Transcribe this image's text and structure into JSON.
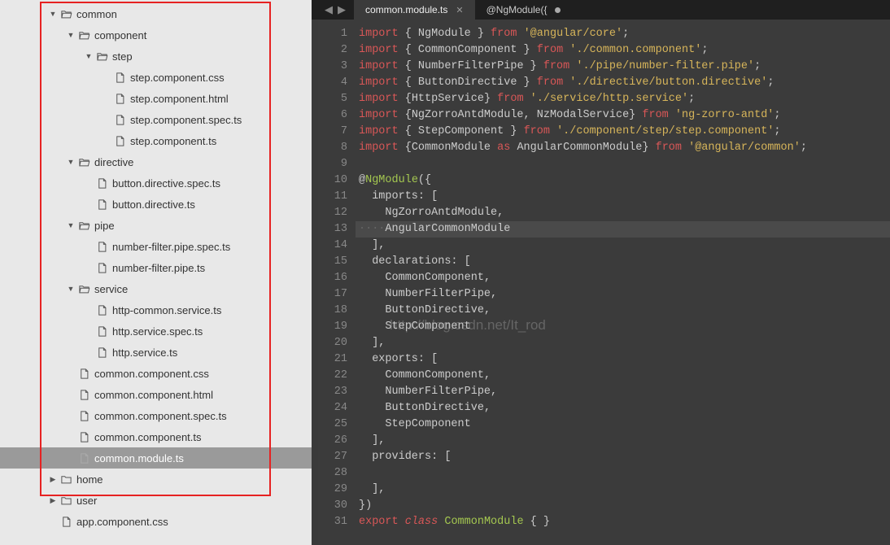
{
  "tabs": [
    {
      "label": "common.module.ts",
      "active": true,
      "dirty": false
    },
    {
      "label": "@NgModule({",
      "active": false,
      "dirty": true
    }
  ],
  "tree": [
    {
      "depth": 0,
      "chev": "down",
      "kind": "folder-open",
      "label": "common"
    },
    {
      "depth": 1,
      "chev": "down",
      "kind": "folder-open",
      "label": "component"
    },
    {
      "depth": 2,
      "chev": "down",
      "kind": "folder-open",
      "label": "step"
    },
    {
      "depth": 3,
      "chev": "",
      "kind": "file",
      "label": "step.component.css"
    },
    {
      "depth": 3,
      "chev": "",
      "kind": "file",
      "label": "step.component.html"
    },
    {
      "depth": 3,
      "chev": "",
      "kind": "file",
      "label": "step.component.spec.ts"
    },
    {
      "depth": 3,
      "chev": "",
      "kind": "file",
      "label": "step.component.ts"
    },
    {
      "depth": 1,
      "chev": "down",
      "kind": "folder-open",
      "label": "directive"
    },
    {
      "depth": 2,
      "chev": "",
      "kind": "file",
      "label": "button.directive.spec.ts"
    },
    {
      "depth": 2,
      "chev": "",
      "kind": "file",
      "label": "button.directive.ts"
    },
    {
      "depth": 1,
      "chev": "down",
      "kind": "folder-open",
      "label": "pipe"
    },
    {
      "depth": 2,
      "chev": "",
      "kind": "file",
      "label": "number-filter.pipe.spec.ts"
    },
    {
      "depth": 2,
      "chev": "",
      "kind": "file",
      "label": "number-filter.pipe.ts"
    },
    {
      "depth": 1,
      "chev": "down",
      "kind": "folder-open",
      "label": "service"
    },
    {
      "depth": 2,
      "chev": "",
      "kind": "file",
      "label": "http-common.service.ts"
    },
    {
      "depth": 2,
      "chev": "",
      "kind": "file",
      "label": "http.service.spec.ts"
    },
    {
      "depth": 2,
      "chev": "",
      "kind": "file",
      "label": "http.service.ts"
    },
    {
      "depth": 1,
      "chev": "",
      "kind": "file",
      "label": "common.component.css"
    },
    {
      "depth": 1,
      "chev": "",
      "kind": "file",
      "label": "common.component.html"
    },
    {
      "depth": 1,
      "chev": "",
      "kind": "file",
      "label": "common.component.spec.ts"
    },
    {
      "depth": 1,
      "chev": "",
      "kind": "file",
      "label": "common.component.ts"
    },
    {
      "depth": 1,
      "chev": "",
      "kind": "file",
      "label": "common.module.ts",
      "selected": true
    },
    {
      "depth": 0,
      "chev": "right",
      "kind": "folder",
      "label": "home"
    },
    {
      "depth": 0,
      "chev": "right",
      "kind": "folder",
      "label": "user"
    },
    {
      "depth": 0,
      "chev": "",
      "kind": "file",
      "label": "app.component.css"
    }
  ],
  "watermark": "http://blog.csdn.net/It_rod",
  "code": [
    {
      "n": 1,
      "t": [
        [
          "kw",
          "import"
        ],
        [
          "punc",
          " { "
        ],
        [
          "ident",
          "NgModule"
        ],
        [
          "punc",
          " } "
        ],
        [
          "kw",
          "from"
        ],
        [
          "punc",
          " "
        ],
        [
          "str",
          "'@angular/core'"
        ],
        [
          "punc",
          ";"
        ]
      ]
    },
    {
      "n": 2,
      "t": [
        [
          "kw",
          "import"
        ],
        [
          "punc",
          " { "
        ],
        [
          "ident",
          "CommonComponent"
        ],
        [
          "punc",
          " } "
        ],
        [
          "kw",
          "from"
        ],
        [
          "punc",
          " "
        ],
        [
          "str",
          "'./common.component'"
        ],
        [
          "punc",
          ";"
        ]
      ]
    },
    {
      "n": 3,
      "t": [
        [
          "kw",
          "import"
        ],
        [
          "punc",
          " { "
        ],
        [
          "ident",
          "NumberFilterPipe"
        ],
        [
          "punc",
          " } "
        ],
        [
          "kw",
          "from"
        ],
        [
          "punc",
          " "
        ],
        [
          "str",
          "'./pipe/number-filter.pipe'"
        ],
        [
          "punc",
          ";"
        ]
      ]
    },
    {
      "n": 4,
      "t": [
        [
          "kw",
          "import"
        ],
        [
          "punc",
          " { "
        ],
        [
          "ident",
          "ButtonDirective"
        ],
        [
          "punc",
          " } "
        ],
        [
          "kw",
          "from"
        ],
        [
          "punc",
          " "
        ],
        [
          "str",
          "'./directive/button.directive'"
        ],
        [
          "punc",
          ";"
        ]
      ]
    },
    {
      "n": 5,
      "t": [
        [
          "kw",
          "import"
        ],
        [
          "punc",
          " {"
        ],
        [
          "ident",
          "HttpService"
        ],
        [
          "punc",
          "} "
        ],
        [
          "kw",
          "from"
        ],
        [
          "punc",
          " "
        ],
        [
          "str",
          "'./service/http.service'"
        ],
        [
          "punc",
          ";"
        ]
      ]
    },
    {
      "n": 6,
      "t": [
        [
          "kw",
          "import"
        ],
        [
          "punc",
          " {"
        ],
        [
          "ident",
          "NgZorroAntdModule"
        ],
        [
          "punc",
          ", "
        ],
        [
          "ident",
          "NzModalService"
        ],
        [
          "punc",
          "} "
        ],
        [
          "kw",
          "from"
        ],
        [
          "punc",
          " "
        ],
        [
          "str",
          "'ng-zorro-antd'"
        ],
        [
          "punc",
          ";"
        ]
      ]
    },
    {
      "n": 7,
      "t": [
        [
          "kw",
          "import"
        ],
        [
          "punc",
          " { "
        ],
        [
          "ident",
          "StepComponent"
        ],
        [
          "punc",
          " } "
        ],
        [
          "kw",
          "from"
        ],
        [
          "punc",
          " "
        ],
        [
          "str",
          "'./component/step/step.component'"
        ],
        [
          "punc",
          ";"
        ]
      ]
    },
    {
      "n": 8,
      "t": [
        [
          "kw",
          "import"
        ],
        [
          "punc",
          " {"
        ],
        [
          "ident",
          "CommonModule"
        ],
        [
          "punc",
          " "
        ],
        [
          "kw",
          "as"
        ],
        [
          "punc",
          " "
        ],
        [
          "ident",
          "AngularCommonModule"
        ],
        [
          "punc",
          "} "
        ],
        [
          "kw",
          "from"
        ],
        [
          "punc",
          " "
        ],
        [
          "str",
          "'@angular/common'"
        ],
        [
          "punc",
          ";"
        ]
      ]
    },
    {
      "n": 9,
      "t": []
    },
    {
      "n": 10,
      "t": [
        [
          "punc",
          "@"
        ],
        [
          "dec",
          "NgModule"
        ],
        [
          "punc",
          "({"
        ]
      ]
    },
    {
      "n": 11,
      "t": [
        [
          "punc",
          "  "
        ],
        [
          "ident",
          "imports"
        ],
        [
          "punc",
          ": ["
        ]
      ]
    },
    {
      "n": 12,
      "t": [
        [
          "punc",
          "    "
        ],
        [
          "ident",
          "NgZorroAntdModule"
        ],
        [
          "punc",
          ","
        ]
      ]
    },
    {
      "n": 13,
      "hl": true,
      "t": [
        [
          "dots",
          "····"
        ],
        [
          "ident",
          "AngularCommonModule"
        ]
      ]
    },
    {
      "n": 14,
      "t": [
        [
          "punc",
          "  ],"
        ]
      ]
    },
    {
      "n": 15,
      "t": [
        [
          "punc",
          "  "
        ],
        [
          "ident",
          "declarations"
        ],
        [
          "punc",
          ": ["
        ]
      ]
    },
    {
      "n": 16,
      "t": [
        [
          "punc",
          "    "
        ],
        [
          "ident",
          "CommonComponent"
        ],
        [
          "punc",
          ","
        ]
      ]
    },
    {
      "n": 17,
      "t": [
        [
          "punc",
          "    "
        ],
        [
          "ident",
          "NumberFilterPipe"
        ],
        [
          "punc",
          ","
        ]
      ]
    },
    {
      "n": 18,
      "t": [
        [
          "punc",
          "    "
        ],
        [
          "ident",
          "ButtonDirective"
        ],
        [
          "punc",
          ","
        ]
      ]
    },
    {
      "n": 19,
      "t": [
        [
          "punc",
          "    "
        ],
        [
          "ident",
          "StepComponent"
        ]
      ]
    },
    {
      "n": 20,
      "t": [
        [
          "punc",
          "  ],"
        ]
      ]
    },
    {
      "n": 21,
      "t": [
        [
          "punc",
          "  "
        ],
        [
          "ident",
          "exports"
        ],
        [
          "punc",
          ": ["
        ]
      ]
    },
    {
      "n": 22,
      "t": [
        [
          "punc",
          "    "
        ],
        [
          "ident",
          "CommonComponent"
        ],
        [
          "punc",
          ","
        ]
      ]
    },
    {
      "n": 23,
      "t": [
        [
          "punc",
          "    "
        ],
        [
          "ident",
          "NumberFilterPipe"
        ],
        [
          "punc",
          ","
        ]
      ]
    },
    {
      "n": 24,
      "t": [
        [
          "punc",
          "    "
        ],
        [
          "ident",
          "ButtonDirective"
        ],
        [
          "punc",
          ","
        ]
      ]
    },
    {
      "n": 25,
      "t": [
        [
          "punc",
          "    "
        ],
        [
          "ident",
          "StepComponent"
        ]
      ]
    },
    {
      "n": 26,
      "t": [
        [
          "punc",
          "  ],"
        ]
      ]
    },
    {
      "n": 27,
      "t": [
        [
          "punc",
          "  "
        ],
        [
          "ident",
          "providers"
        ],
        [
          "punc",
          ": ["
        ]
      ]
    },
    {
      "n": 28,
      "t": []
    },
    {
      "n": 29,
      "t": [
        [
          "punc",
          "  ],"
        ]
      ]
    },
    {
      "n": 30,
      "t": [
        [
          "punc",
          "})"
        ]
      ]
    },
    {
      "n": 31,
      "t": [
        [
          "kw",
          "export"
        ],
        [
          "punc",
          " "
        ],
        [
          "kw2",
          "class"
        ],
        [
          "punc",
          " "
        ],
        [
          "type",
          "CommonModule"
        ],
        [
          "punc",
          " { }"
        ]
      ]
    }
  ]
}
